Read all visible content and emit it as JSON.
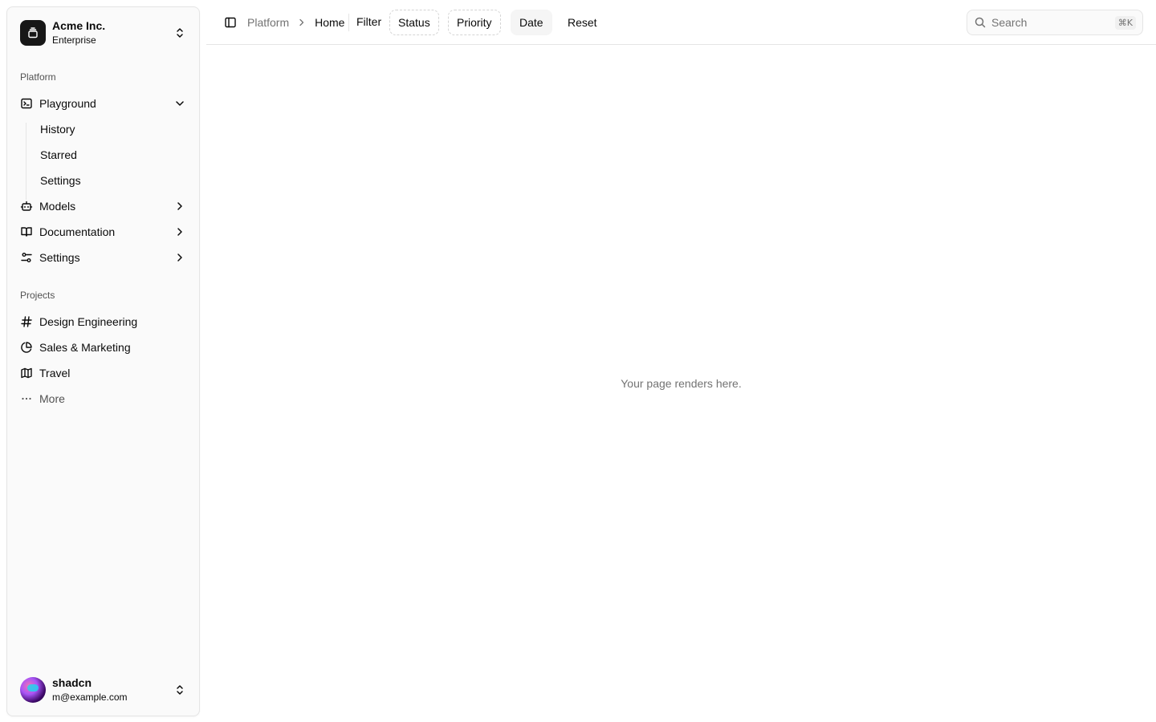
{
  "team": {
    "name": "Acme Inc.",
    "plan": "Enterprise"
  },
  "platform_group": {
    "label": "Platform",
    "items": [
      {
        "label": "Playground",
        "icon": "terminal-icon",
        "expanded": true,
        "subitems": [
          "History",
          "Starred",
          "Settings"
        ]
      },
      {
        "label": "Models",
        "icon": "bot-icon"
      },
      {
        "label": "Documentation",
        "icon": "book-icon"
      },
      {
        "label": "Settings",
        "icon": "sliders-icon"
      }
    ]
  },
  "projects_group": {
    "label": "Projects",
    "items": [
      {
        "label": "Design Engineering",
        "icon": "hash-icon"
      },
      {
        "label": "Sales & Marketing",
        "icon": "pie-chart-icon"
      },
      {
        "label": "Travel",
        "icon": "map-icon"
      },
      {
        "label": "More",
        "icon": "ellipsis-icon"
      }
    ]
  },
  "user": {
    "name": "shadcn",
    "email": "m@example.com"
  },
  "breadcrumb": {
    "parent": "Platform",
    "current": "Home"
  },
  "filters": {
    "label": "Filter",
    "chips": [
      "Status",
      "Priority",
      "Date"
    ],
    "reset": "Reset"
  },
  "search": {
    "placeholder": "Search",
    "shortcut": "⌘K"
  },
  "main": {
    "placeholder": "Your page renders here."
  },
  "colors": {
    "muted_text": "#737373",
    "border": "#e5e5e5",
    "sidebar_bg": "#fafafa",
    "logo_bg": "#171717"
  }
}
